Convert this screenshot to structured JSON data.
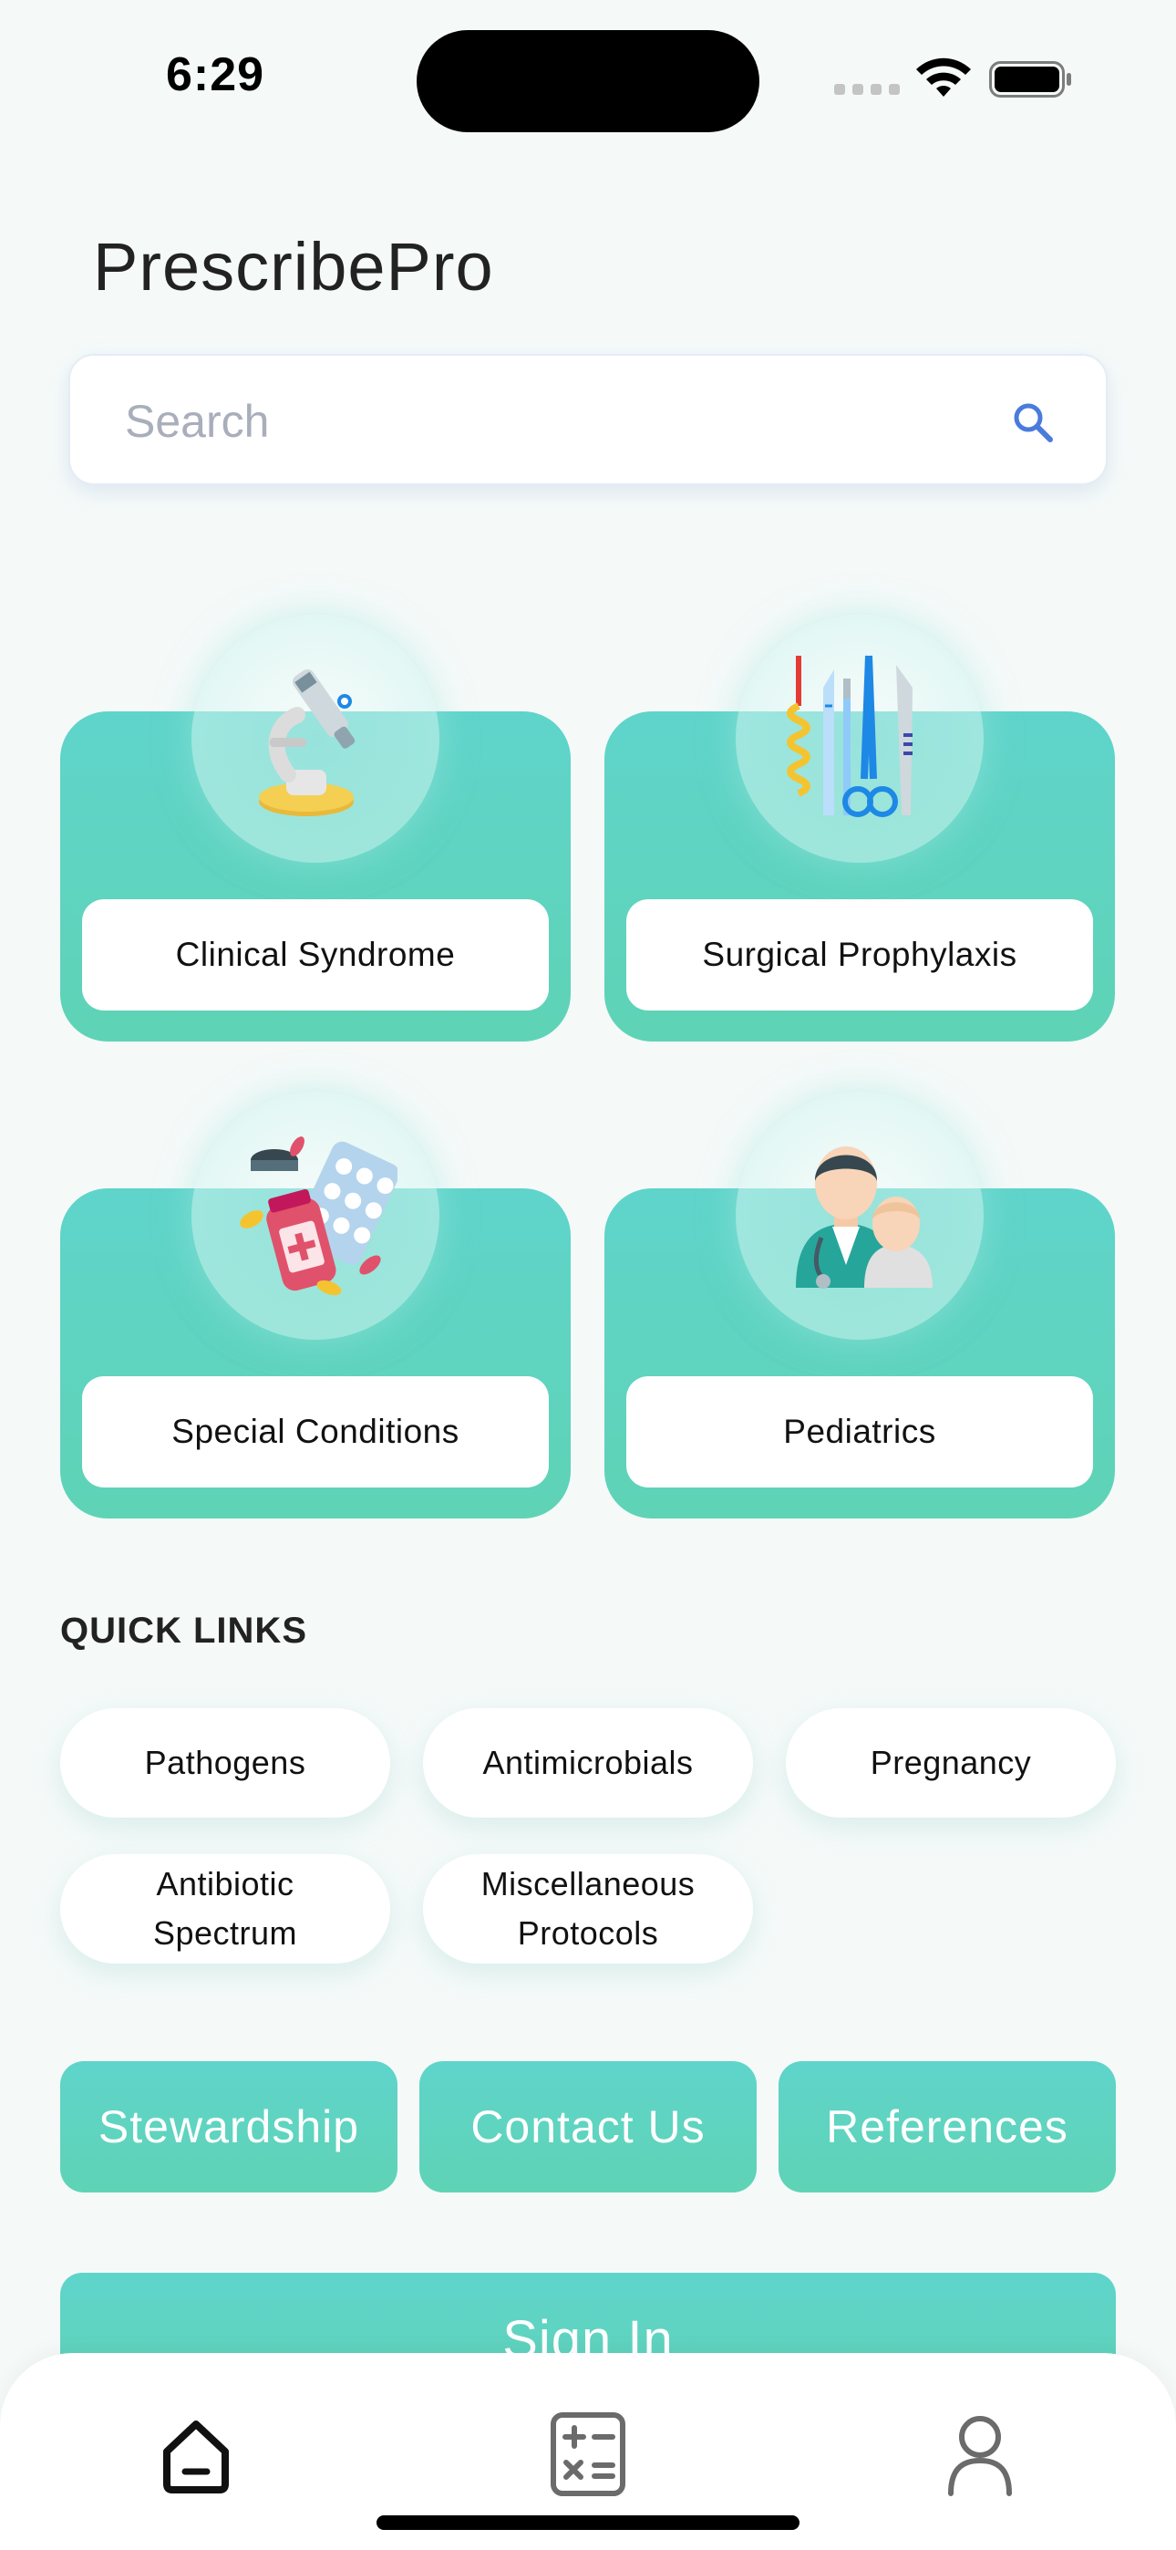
{
  "status_bar": {
    "time": "6:29"
  },
  "app": {
    "title": "PrescribePro"
  },
  "search": {
    "placeholder": "Search"
  },
  "categories": [
    {
      "label": "Clinical Syndrome",
      "icon": "microscope-icon"
    },
    {
      "label": "Surgical Prophylaxis",
      "icon": "surgical-tools-icon"
    },
    {
      "label": "Special Conditions",
      "icon": "medications-icon"
    },
    {
      "label": "Pediatrics",
      "icon": "doctor-child-icon"
    }
  ],
  "quick_links": {
    "heading": "QUICK LINKS",
    "items": [
      "Pathogens",
      "Antimicrobials",
      "Pregnancy",
      "Antibiotic Spectrum",
      "Miscellaneous Protocols"
    ]
  },
  "buttons": {
    "stewardship": "Stewardship",
    "contact_us": "Contact Us",
    "references": "References",
    "sign_in": "Sign In"
  },
  "tab_bar": {
    "items": [
      {
        "icon": "home-icon",
        "active": true
      },
      {
        "icon": "calculator-icon",
        "active": false
      },
      {
        "icon": "profile-icon",
        "active": false
      }
    ]
  },
  "colors": {
    "accent": "#5fd4cb",
    "accent_bottom": "#5fd3b5",
    "background": "#f5faf9",
    "search_icon": "#4a7bdc"
  }
}
